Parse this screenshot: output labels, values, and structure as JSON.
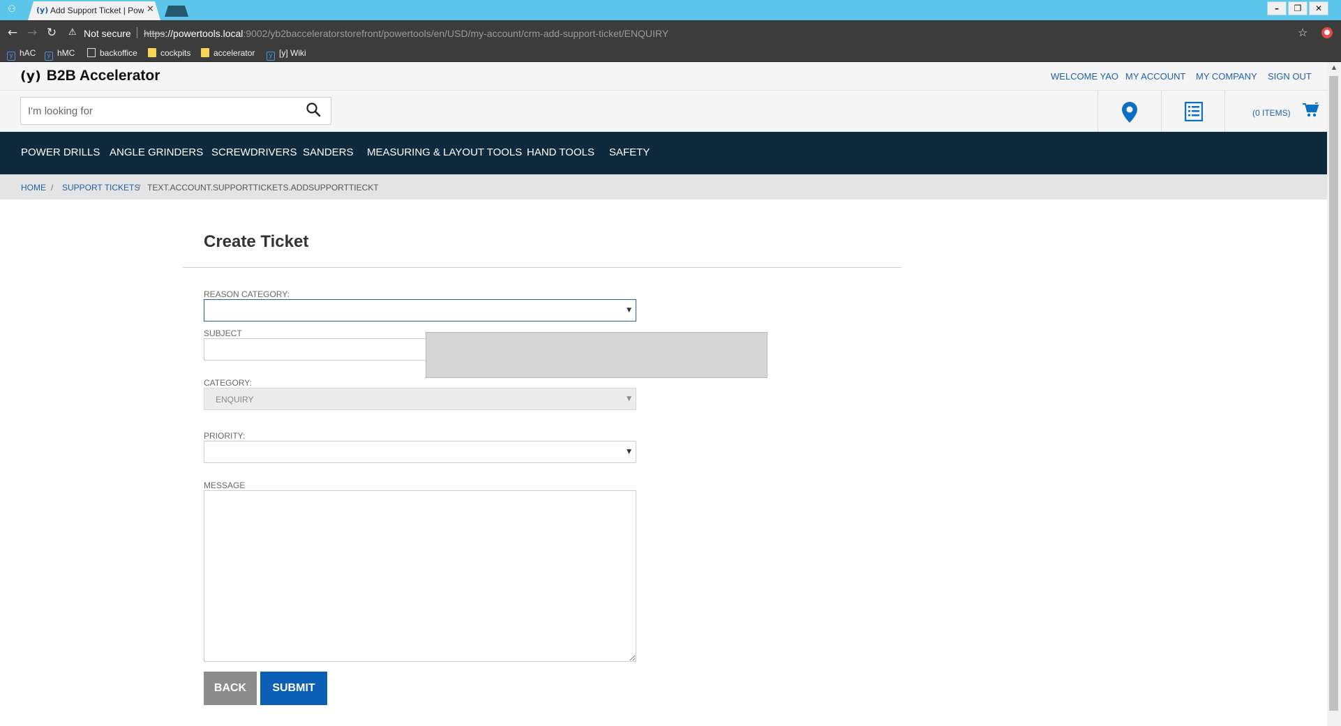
{
  "browser": {
    "tab_title": "Add Support Ticket | Pow",
    "tab_favicon": "(y)",
    "security_label": "Not secure",
    "url_scheme": "https",
    "url_host": "://powertools.local",
    "url_rest": ":9002/yb2bacceleratorstorefront/powertools/en/USD/my-account/crm-add-support-ticket/ENQUIRY",
    "bookmarks": [
      {
        "label": "hAC",
        "icon": "y-logo-icon"
      },
      {
        "label": "hMC",
        "icon": "y-logo-icon"
      },
      {
        "label": "backoffice",
        "icon": "page-icon"
      },
      {
        "label": "cockpits",
        "icon": "folder-icon"
      },
      {
        "label": "accelerator",
        "icon": "folder-icon"
      },
      {
        "label": "[y] Wiki",
        "icon": "y-logo-icon"
      }
    ]
  },
  "header": {
    "logo_mark": "(y)",
    "brand": "B2B Accelerator",
    "account_links": [
      "WELCOME YAO",
      "MY ACCOUNT",
      "MY COMPANY",
      "SIGN OUT"
    ],
    "search_placeholder": "I'm looking for",
    "cart_label": "(0 ITEMS)"
  },
  "nav": {
    "items": [
      "POWER DRILLS",
      "ANGLE GRINDERS",
      "SCREWDRIVERS",
      "SANDERS",
      "MEASURING & LAYOUT TOOLS",
      "HAND TOOLS",
      "SAFETY"
    ]
  },
  "breadcrumb": {
    "items": [
      "HOME",
      "SUPPORT TICKETS",
      "TEXT.ACCOUNT.SUPPORTTICKETS.ADDSUPPORTTIECKT"
    ],
    "separator": "/"
  },
  "form": {
    "title": "Create Ticket",
    "reason_category_label": "REASON CATEGORY:",
    "reason_category_value": "",
    "subject_label": "SUBJECT",
    "subject_value": "",
    "category_label": "CATEGORY:",
    "category_value": "ENQUIRY",
    "priority_label": "PRIORITY:",
    "priority_value": "",
    "message_label": "MESSAGE",
    "message_value": "",
    "back_label": "BACK",
    "submit_label": "SUBMIT"
  },
  "colors": {
    "tabstrip": "#5bc6ea",
    "navbar": "#0f2a3d",
    "link": "#1b62a9",
    "submit": "#0b5fb4",
    "back": "#8c8c8c"
  }
}
